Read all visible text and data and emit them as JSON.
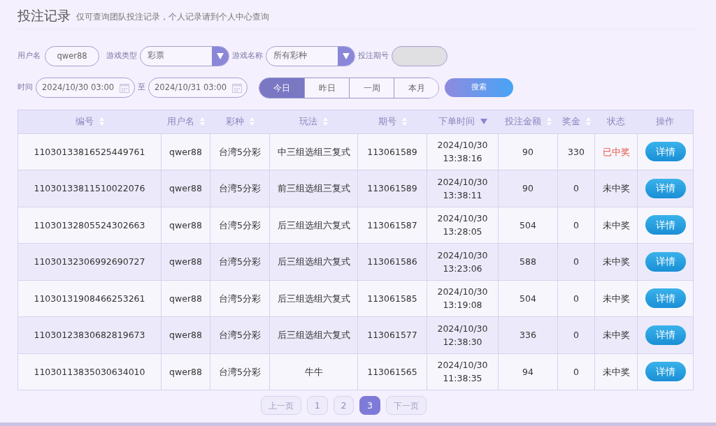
{
  "page": {
    "title": "投注记录",
    "subtitle": "仅可查询团队投注记录，个人记录请到个人中心查询"
  },
  "filters": {
    "username": {
      "label": "用户名",
      "value": "qwer88"
    },
    "game_type": {
      "label": "游戏类型",
      "value": "彩票"
    },
    "game_name": {
      "label": "游戏名称",
      "value": "所有彩种"
    },
    "issue": {
      "label": "投注期号",
      "disabled": true
    },
    "time": {
      "label": "时间",
      "start": "2024/10/30 03:00",
      "separator": "至",
      "end": "2024/10/31 03:00"
    },
    "ranges": [
      {
        "label": "今日",
        "selected": true
      },
      {
        "label": "昨日",
        "selected": false
      },
      {
        "label": "一周",
        "selected": false
      },
      {
        "label": "本月",
        "selected": false
      }
    ],
    "search_button": "搜索"
  },
  "table": {
    "columns": [
      {
        "label": "编号",
        "kind": "sortable"
      },
      {
        "label": "用户名",
        "kind": "sortable"
      },
      {
        "label": "彩种",
        "kind": "sortable"
      },
      {
        "label": "玩法",
        "kind": "sortable"
      },
      {
        "label": "期号",
        "kind": "sortable"
      },
      {
        "label": "下单时间",
        "kind": "sorted"
      },
      {
        "label": "投注金额",
        "kind": "sortable"
      },
      {
        "label": "奖金",
        "kind": "sortable"
      },
      {
        "label": "状态",
        "kind": "plain"
      },
      {
        "label": "操作",
        "kind": "plain"
      }
    ],
    "rows": [
      {
        "id": "11030133816525449761",
        "user": "qwer88",
        "lottery": "台湾5分彩",
        "play": "中三组选组三复式",
        "issue": "113061589",
        "date": "2024/10/30",
        "time": "13:38:16",
        "amount": "90",
        "prize": "330",
        "status": "已中奖",
        "won": true,
        "action": "详情"
      },
      {
        "id": "11030133811510022076",
        "user": "qwer88",
        "lottery": "台湾5分彩",
        "play": "前三组选组三复式",
        "issue": "113061589",
        "date": "2024/10/30",
        "time": "13:38:11",
        "amount": "90",
        "prize": "0",
        "status": "未中奖",
        "won": false,
        "action": "详情"
      },
      {
        "id": "11030132805524302663",
        "user": "qwer88",
        "lottery": "台湾5分彩",
        "play": "后三组选组六复式",
        "issue": "113061587",
        "date": "2024/10/30",
        "time": "13:28:05",
        "amount": "504",
        "prize": "0",
        "status": "未中奖",
        "won": false,
        "action": "详情"
      },
      {
        "id": "11030132306992690727",
        "user": "qwer88",
        "lottery": "台湾5分彩",
        "play": "后三组选组六复式",
        "issue": "113061586",
        "date": "2024/10/30",
        "time": "13:23:06",
        "amount": "588",
        "prize": "0",
        "status": "未中奖",
        "won": false,
        "action": "详情"
      },
      {
        "id": "11030131908466253261",
        "user": "qwer88",
        "lottery": "台湾5分彩",
        "play": "后三组选组六复式",
        "issue": "113061585",
        "date": "2024/10/30",
        "time": "13:19:08",
        "amount": "504",
        "prize": "0",
        "status": "未中奖",
        "won": false,
        "action": "详情"
      },
      {
        "id": "11030123830682819673",
        "user": "qwer88",
        "lottery": "台湾5分彩",
        "play": "后三组选组六复式",
        "issue": "113061577",
        "date": "2024/10/30",
        "time": "12:38:30",
        "amount": "336",
        "prize": "0",
        "status": "未中奖",
        "won": false,
        "action": "详情"
      },
      {
        "id": "11030113835030634010",
        "user": "qwer88",
        "lottery": "台湾5分彩",
        "play": "牛牛",
        "issue": "113061565",
        "date": "2024/10/30",
        "time": "11:38:35",
        "amount": "94",
        "prize": "0",
        "status": "未中奖",
        "won": false,
        "action": "详情"
      }
    ]
  },
  "pagination": {
    "prev": {
      "label": "上一页",
      "disabled": true
    },
    "pages": [
      {
        "label": "1",
        "selected": false
      },
      {
        "label": "2",
        "selected": false
      },
      {
        "label": "3",
        "selected": true
      }
    ],
    "next": {
      "label": "下一页",
      "disabled": true
    }
  }
}
